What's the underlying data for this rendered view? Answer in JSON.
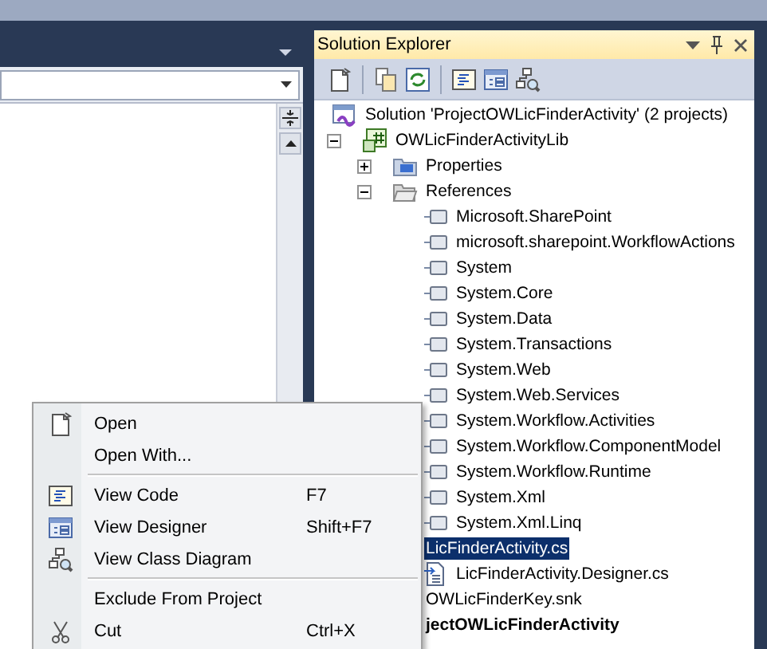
{
  "solution_explorer": {
    "title": "Solution Explorer",
    "tree": [
      {
        "label": "Solution 'ProjectOWLicFinderActivity' (2 projects)",
        "kind": "solution",
        "selected": false,
        "children": [
          {
            "label": "OWLicFinderActivityLib",
            "kind": "project",
            "selected": false,
            "expanded": true,
            "children": [
              {
                "label": "Properties",
                "kind": "properties",
                "selected": false,
                "expanded": false
              },
              {
                "label": "References",
                "kind": "folder",
                "selected": false,
                "expanded": true,
                "children": [
                  {
                    "label": "Microsoft.SharePoint",
                    "kind": "reference",
                    "selected": false
                  },
                  {
                    "label": "microsoft.sharepoint.WorkflowActions",
                    "kind": "reference",
                    "selected": false
                  },
                  {
                    "label": "System",
                    "kind": "reference",
                    "selected": false
                  },
                  {
                    "label": "System.Core",
                    "kind": "reference",
                    "selected": false
                  },
                  {
                    "label": "System.Data",
                    "kind": "reference",
                    "selected": false
                  },
                  {
                    "label": "System.Transactions",
                    "kind": "reference",
                    "selected": false
                  },
                  {
                    "label": "System.Web",
                    "kind": "reference",
                    "selected": false
                  },
                  {
                    "label": "System.Web.Services",
                    "kind": "reference",
                    "selected": false
                  },
                  {
                    "label": "System.Workflow.Activities",
                    "kind": "reference",
                    "selected": false
                  },
                  {
                    "label": "System.Workflow.ComponentModel",
                    "kind": "reference",
                    "selected": false
                  },
                  {
                    "label": "System.Workflow.Runtime",
                    "kind": "reference",
                    "selected": false
                  },
                  {
                    "label": "System.Xml",
                    "kind": "reference",
                    "selected": false
                  },
                  {
                    "label": "System.Xml.Linq",
                    "kind": "reference",
                    "selected": false
                  }
                ]
              },
              {
                "label": "LicFinderActivity.cs",
                "kind": "hidden",
                "selected": true,
                "children": [
                  {
                    "label": "LicFinderActivity.Designer.cs",
                    "kind": "file",
                    "selected": false
                  }
                ]
              },
              {
                "label": "OWLicFinderKey.snk",
                "kind": "hidden",
                "selected": false
              },
              {
                "label": "jectOWLicFinderActivity",
                "kind": "hidden",
                "selected": false,
                "bold": true
              }
            ]
          }
        ]
      }
    ]
  },
  "context_menu": [
    {
      "kind": "file",
      "label": "Open"
    },
    {
      "kind": "plain",
      "label": "Open With..."
    },
    {
      "kind": "separator"
    },
    {
      "kind": "code",
      "label": "View Code",
      "shortcut": "F7"
    },
    {
      "kind": "designer",
      "label": "View Designer",
      "shortcut": "Shift+F7"
    },
    {
      "kind": "diagram",
      "label": "View Class Diagram"
    },
    {
      "kind": "separator"
    },
    {
      "kind": "plain",
      "label": "Exclude From Project"
    },
    {
      "kind": "scissors",
      "label": "Cut",
      "shortcut": "Ctrl+X"
    }
  ]
}
